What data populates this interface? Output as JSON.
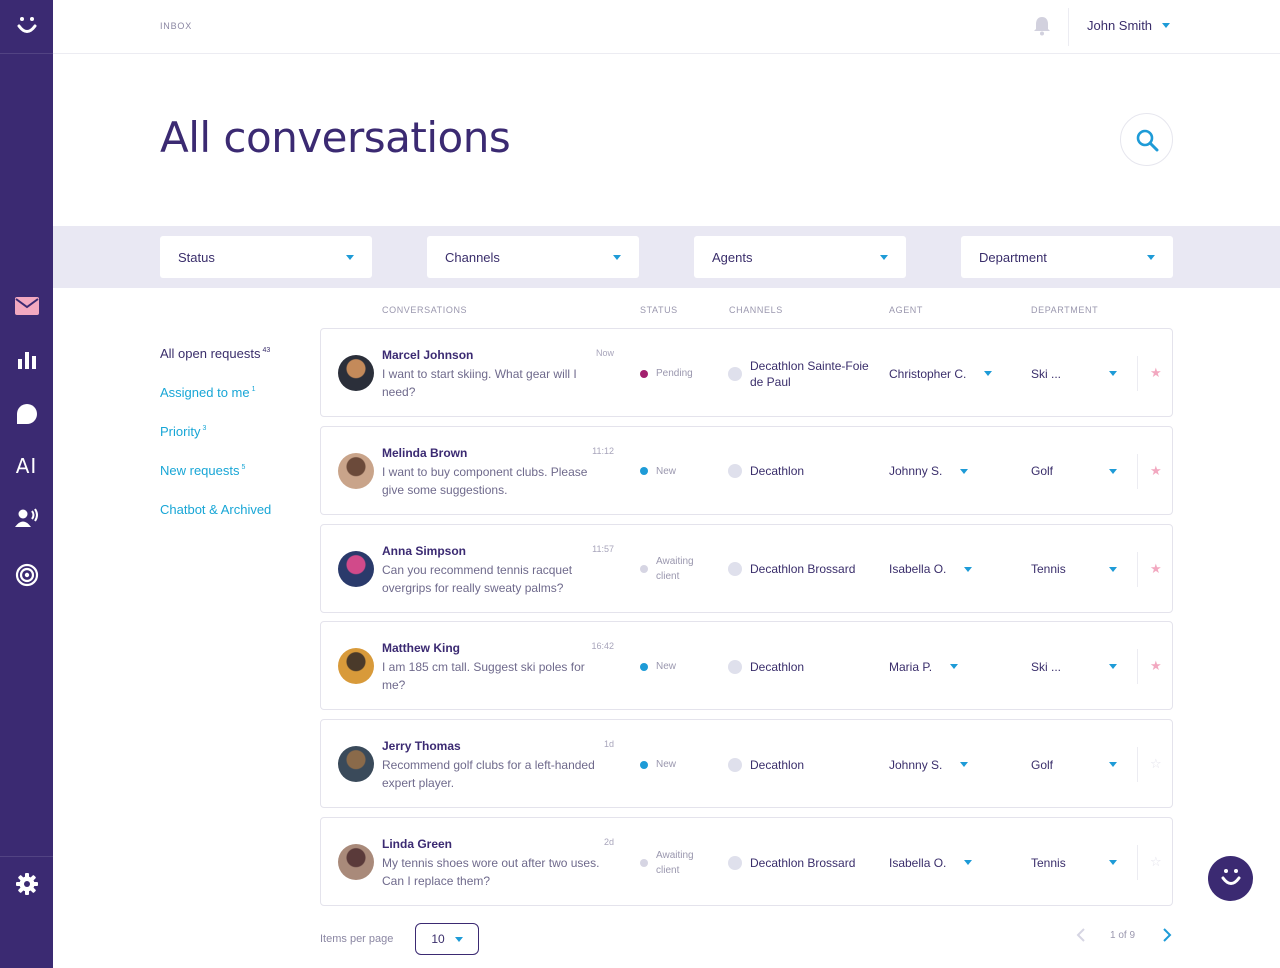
{
  "colors": {
    "sidebar": "#3b2a72",
    "accent": "#1e9bd7",
    "pending": "#a3206e",
    "new": "#1e9bd7",
    "awaiting": "#d6d5e3",
    "star_on": "#f2a8c0",
    "star_off": "#e4e3ec"
  },
  "sidebar": {
    "logo_icon": "smiley-icon",
    "items": [
      {
        "icon": "mail-icon"
      },
      {
        "icon": "bar-chart-icon"
      },
      {
        "icon": "chat-bubble-icon"
      },
      {
        "label": "AI"
      },
      {
        "icon": "voice-user-icon"
      },
      {
        "icon": "target-icon"
      }
    ],
    "settings_icon": "gear-icon"
  },
  "header": {
    "breadcrumb": "INBOX",
    "user_name": "John Smith"
  },
  "page": {
    "title": "All conversations"
  },
  "filters": [
    "Status",
    "Channels",
    "Agents",
    "Department"
  ],
  "leftnav": [
    {
      "label": "All open requests",
      "count": "43"
    },
    {
      "label": "Assigned to me",
      "count": "1"
    },
    {
      "label": "Priority",
      "count": "3"
    },
    {
      "label": "New requests",
      "count": "5"
    },
    {
      "label": "Chatbot & Archived",
      "count": ""
    }
  ],
  "columns": {
    "conversations": "CONVERSATIONS",
    "status": "STATUS",
    "channels": "CHANNELS",
    "agent": "AGENT",
    "department": "DEPARTMENT"
  },
  "rows": [
    {
      "name": "Marcel Johnson",
      "time": "Now",
      "message": "I want to start skiing. What gear will I need?",
      "status": "Pending",
      "status_type": "pending",
      "channel": "Decathlon Sainte-Foie de Paul",
      "agent": "Christopher C.",
      "department": "Ski ...",
      "starred": true
    },
    {
      "name": "Melinda Brown",
      "time": "11:12",
      "message": "I want to buy component clubs. Please give some suggestions.",
      "status": "New",
      "status_type": "new",
      "channel": "Decathlon",
      "agent": "Johnny S.",
      "department": "Golf",
      "starred": true
    },
    {
      "name": "Anna Simpson",
      "time": "11:57",
      "message": "Can you recommend tennis racquet overgrips for really sweaty palms?",
      "status": "Awaiting client",
      "status_type": "awaiting",
      "channel": "Decathlon Brossard",
      "agent": "Isabella O.",
      "department": "Tennis",
      "starred": true
    },
    {
      "name": "Matthew King",
      "time": "16:42",
      "message": "I am 185 cm tall. Suggest ski poles for me?",
      "status": "New",
      "status_type": "new",
      "channel": "Decathlon",
      "agent": "Maria P.",
      "department": "Ski ...",
      "starred": true
    },
    {
      "name": "Jerry Thomas",
      "time": "1d",
      "message": "Recommend golf clubs for a left-handed expert player.",
      "status": "New",
      "status_type": "new",
      "channel": "Decathlon",
      "agent": "Johnny S.",
      "department": "Golf",
      "starred": false
    },
    {
      "name": "Linda Green",
      "time": "2d",
      "message": "My tennis shoes wore out after two uses. Can I replace them?",
      "status": "Awaiting client",
      "status_type": "awaiting",
      "channel": "Decathlon Brossard",
      "agent": "Isabella O.",
      "department": "Tennis",
      "starred": false
    }
  ],
  "pagination": {
    "items_per_page_label": "Items per page",
    "items_per_page": "10",
    "page_text": "1 of 9"
  }
}
